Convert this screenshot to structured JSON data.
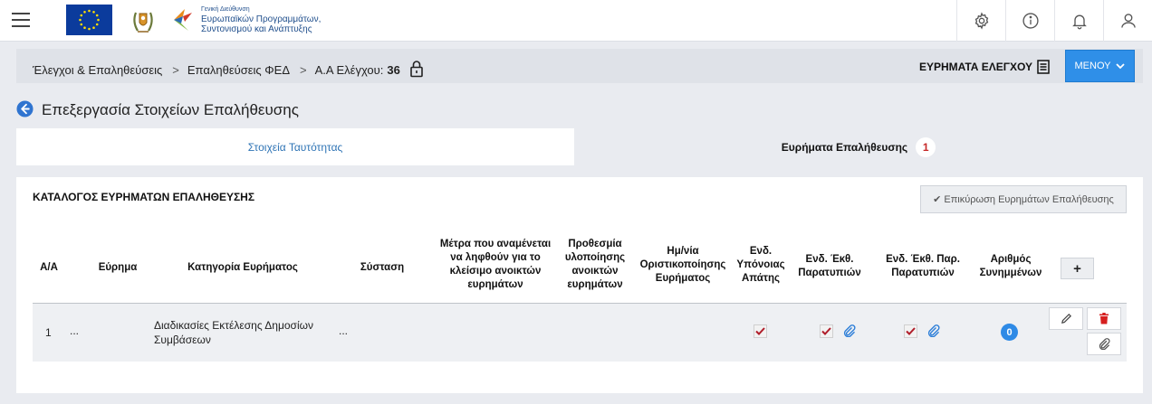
{
  "header": {
    "gd_logo": {
      "line0": "Γενική Διεύθυνση",
      "line1": "Ευρωπαϊκών Προγραμμάτων,",
      "line2": "Συντονισμού και Ανάπτυξης"
    },
    "icons": [
      "gear-icon",
      "info-icon",
      "bell-icon",
      "user-icon"
    ]
  },
  "breadcrumb": {
    "items": [
      "Έλεγχοι & Επαληθεύσεις",
      "Επαληθεύσεις ΦΕΔ"
    ],
    "control_label": "Α.Α Ελέγχου:",
    "control_number": "36",
    "findings_label": "ΕΥΡΗΜΑΤΑ ΕΛΕΓΧΟΥ",
    "menu_label": "ΜΕΝΟΥ"
  },
  "page": {
    "title": "Επεξεργασία Στοιχείων Επαλήθευσης"
  },
  "tabs": {
    "identity": "Στοιχεία Ταυτότητας",
    "findings": "Ευρήματα Επαλήθευσης",
    "findings_count": "1"
  },
  "panel": {
    "title": "ΚΑΤΑΛΟΓΟΣ ΕΥΡΗΜΑΤΩΝ ΕΠΑΛΗΘΕΥΣΗΣ",
    "confirm_button": "Επικύρωση Ευρημάτων Επαλήθευσης",
    "add_button": "+"
  },
  "table": {
    "headers": {
      "aa": "Α/Α",
      "finding": "Εύρημα",
      "category": "Κατηγορία Ευρήματος",
      "recommendation": "Σύσταση",
      "measures": "Μέτρα που αναμένεται να ληφθούν για το κλείσιμο ανοικτών ευρημάτων",
      "deadline": "Προθεσμία υλοποίησης ανοικτών ευρημάτων",
      "final_date": "Ημ/νία Οριστικοποίησης Ευρήματος",
      "fraud": "Ενδ. Υπόνοιας Απάτης",
      "report": "Ενδ. Έκθ. Παρατυπιών",
      "report_part": "Ενδ. Έκθ. Παρ. Παρατυπιών",
      "attachments": "Αριθμός Συνημμένων"
    },
    "rows": [
      {
        "aa": "1",
        "finding": "...",
        "category": "Διαδικασίες Εκτέλεσης Δημοσίων Συμβάσεων",
        "recommendation": "...",
        "fraud_checked": true,
        "report_checked": true,
        "report_part_checked": true,
        "attachments": "0"
      }
    ]
  },
  "colors": {
    "accent": "#2f8fe8",
    "badge_red": "#c62828",
    "link_blue": "#2f74b5"
  }
}
